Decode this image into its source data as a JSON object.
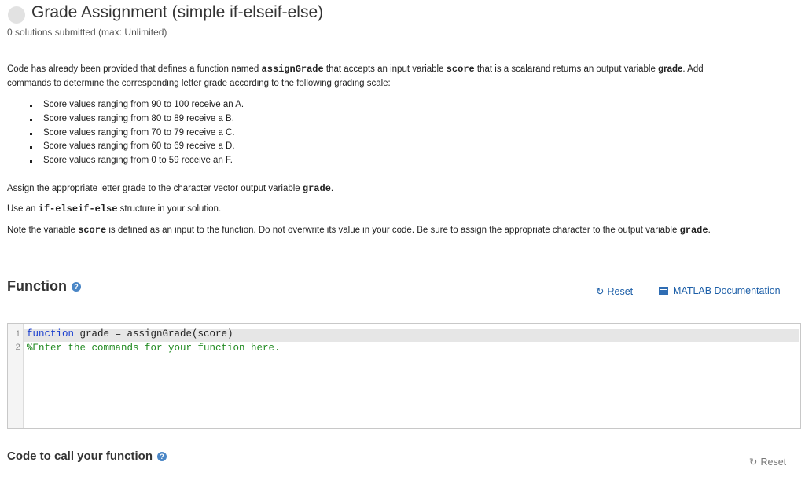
{
  "header": {
    "title": "Grade Assignment (simple if-elseif-else)",
    "submissions": "0 solutions submitted (max: Unlimited)"
  },
  "description": {
    "p1_a": "Code has already been provided that defines a function named ",
    "p1_func": "assignGrade",
    "p1_b": " that accepts an input variable ",
    "p1_score": "score",
    "p1_c": " that is a scalarand returns an output variable ",
    "p1_grade": "grade",
    "p1_d": ".  Add",
    "p1_line2": "commands to determine the corresponding letter grade according to the following grading scale:",
    "scale": [
      "Score values ranging from 90 to 100 receive an A.",
      "Score values ranging from 80 to 89 receive a B.",
      "Score values ranging from 70 to 79 receive a C.",
      "Score values ranging from 60 to 69 receive a D.",
      "Score values ranging from 0 to 59 receive an F."
    ],
    "p2_a": "Assign the appropriate letter grade to the character vector output variable ",
    "p2_grade": "grade",
    "p2_b": ".",
    "p3_a": "Use an ",
    "p3_code": "if-elseif-else",
    "p3_b": " structure in your solution.",
    "p4_a": "Note the variable ",
    "p4_score": "score",
    "p4_b": " is defined as an input to the function.  Do not overwrite its value in your code.  Be sure to assign the appropriate character to the output variable ",
    "p4_grade": "grade",
    "p4_c": "."
  },
  "function_section": {
    "title": "Function",
    "help_icon": "question-circle-icon",
    "reset_label": "Reset",
    "reset_icon": "refresh-icon",
    "docs_label": "MATLAB Documentation",
    "docs_icon": "book-icon"
  },
  "editor": {
    "line_numbers": [
      "1",
      "2"
    ],
    "line1_keyword": "function",
    "line1_rest": " grade = assignGrade(score)",
    "line2_comment": "%Enter the commands for your function here."
  },
  "call_section": {
    "title": "Code to call your function",
    "reset_label": "Reset"
  },
  "colors": {
    "link": "#1d5fa8",
    "keyword": "#1a3fcf",
    "comment": "#228b22",
    "help_icon": "#4a86c6"
  }
}
